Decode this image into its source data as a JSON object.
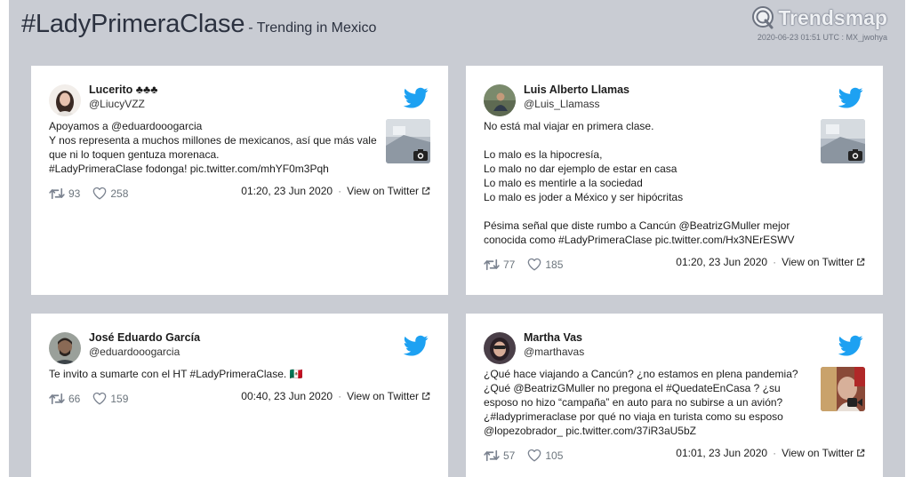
{
  "header": {
    "hashtag": "#LadyPrimeraClase",
    "subtitle": "- Trending in Mexico",
    "brand": "Trendsmap",
    "meta": "2020-06-23 01:51 UTC : MX_jwohya"
  },
  "colors": {
    "twitter_blue": "#1da1f2",
    "page_bg": "#c9ccd3",
    "card_bg": "#ffffff"
  },
  "icons": {
    "brand": "trendsmap-pin-icon",
    "bird": "twitter-bird-icon",
    "retweet": "retweet-icon",
    "like": "heart-icon",
    "external": "external-link-icon",
    "camera": "camera-icon",
    "video": "video-icon"
  },
  "tweets": [
    {
      "name": "Lucerito ♣♣♣",
      "handle": "@LiucyVZZ",
      "text": "Apoyamos a @eduardooogarcia\nY nos representa a muchos millones de mexicanos, así que más vale que ni lo toquen gentuza morenaca.\n#LadyPrimeraClase fodonga! pic.twitter.com/mhYF0m3Pqh",
      "retweets": "93",
      "likes": "258",
      "time": "01:20, 23 Jun 2020",
      "view_label": "View on Twitter"
    },
    {
      "name": "Luis Alberto Llamas",
      "handle": "@Luis_Llamass",
      "text": "No está mal viajar en primera clase.\n\nLo malo es la hipocresía,\nLo malo no dar ejemplo de estar en casa\nLo malo es mentirle a la sociedad\nLo malo es joder a México y ser hipócritas\n\nPésima señal que diste rumbo a Cancún @BeatrizGMuller mejor conocida como #LadyPrimeraClase pic.twitter.com/Hx3NErESWV",
      "retweets": "77",
      "likes": "185",
      "time": "01:20, 23 Jun 2020",
      "view_label": "View on Twitter"
    },
    {
      "name": "José Eduardo García",
      "handle": "@eduardooogarcia",
      "text": "Te invito a sumarte con el HT #LadyPrimeraClase. 🇲🇽",
      "retweets": "66",
      "likes": "159",
      "time": "00:40, 23 Jun 2020",
      "view_label": "View on Twitter"
    },
    {
      "name": "Martha Vas",
      "handle": "@marthavas",
      "text": "¿Qué hace viajando a Cancún? ¿no estamos en plena pandemia? ¿Qué @BeatrizGMuller no pregona el #QuedateEnCasa ? ¿su esposo no hizo “campaña” en auto para no subirse a un avión? ¿#ladyprimeraclase por qué no viaja en turista como su esposo @lopezobrador_ pic.twitter.com/37iR3aU5bZ",
      "retweets": "57",
      "likes": "105",
      "time": "01:01, 23 Jun 2020",
      "view_label": "View on Twitter"
    }
  ]
}
